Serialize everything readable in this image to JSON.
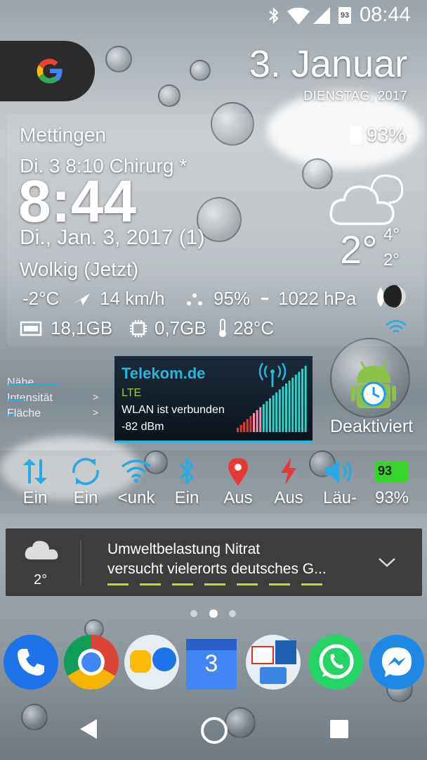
{
  "status_bar": {
    "time": "08:44",
    "sim_badge": "93"
  },
  "date_widget": {
    "date": "3. Januar",
    "weekday_year": "DIENSTAG, 2017"
  },
  "weather_widget": {
    "location": "Mettingen",
    "battery": "93%",
    "alarm": "Di. 3 8:10 Chirurg *",
    "clock": "8:44",
    "full_date": "Di., Jan. 3, 2017 (1)",
    "condition": "Wolkig (Jetzt)",
    "temp": "-2°C",
    "wind": "14 km/h",
    "humidity": "95%",
    "pressure": "1022 hPa",
    "storage": "18,1GB",
    "ram": "0,7GB",
    "cpu_temp": "28°C",
    "current_temp": "2°",
    "high": "4°",
    "low": "2°"
  },
  "rain_legend": {
    "items": [
      "Nähe",
      "Intensität",
      "Fläche"
    ],
    "arrow": ">"
  },
  "telekom": {
    "carrier": "Telekom.de",
    "network": "LTE",
    "wlan": "WLAN ist verbunden",
    "signal": "-82 dBm"
  },
  "android_widget": {
    "label": "Deaktiviert"
  },
  "quick_settings": [
    {
      "icon": "data-transfer-icon",
      "label": "Ein"
    },
    {
      "icon": "sync-icon",
      "label": "Ein"
    },
    {
      "icon": "wifi-icon",
      "label": "<unk"
    },
    {
      "icon": "bluetooth-icon",
      "label": "Ein"
    },
    {
      "icon": "location-icon",
      "label": "Aus"
    },
    {
      "icon": "flash-icon",
      "label": "Aus"
    },
    {
      "icon": "volume-icon",
      "label": "Läu-"
    },
    {
      "icon": "battery-icon",
      "label": "93%",
      "battery_level": "93"
    }
  ],
  "news": {
    "temp": "2°",
    "line1": "Umweltbelastung Nitrat",
    "line2": "versucht vielerorts deutsches G..."
  },
  "dock": [
    "phone-icon",
    "chrome-icon",
    "messages-icon",
    "calendar-icon",
    "mail-icon",
    "whatsapp-icon",
    "messenger-icon"
  ],
  "calendar_day": "3"
}
